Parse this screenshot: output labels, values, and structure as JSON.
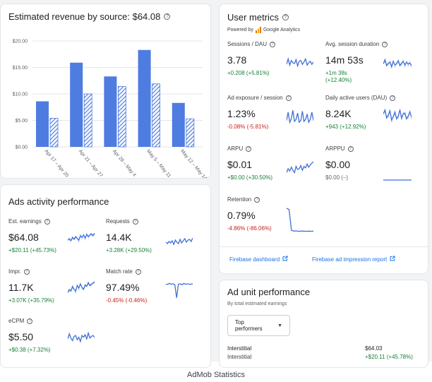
{
  "colors": {
    "bar_solid": "#4e7ce0",
    "bar_hatched": "#4e7ce0",
    "spark_primary": "#3f6fd6",
    "spark_secondary": "#b7c9f0",
    "positive": "#188038",
    "negative": "#c5221f",
    "link": "#1a73e8",
    "firebase_logo": "#f5a623"
  },
  "revenue_card": {
    "title": "Estimated revenue by source: $64.08",
    "help_icon": "help-circle-icon"
  },
  "chart_data": {
    "type": "bar",
    "categories": [
      "Apr 17 – Apr 20",
      "Apr 21 – Apr 27",
      "Apr 28 – May 4",
      "May 5 – May 11",
      "May 12 – May 14"
    ],
    "series": [
      {
        "values": [
          8.6,
          15.9,
          13.3,
          18.3,
          8.3
        ]
      },
      {
        "values": [
          5.4,
          10.0,
          11.4,
          11.9,
          5.3
        ]
      }
    ],
    "ylim": [
      0,
      20
    ],
    "yticks": [
      "$0.00",
      "$5.00",
      "$10.00",
      "$15.00",
      "$20.00"
    ],
    "ytick_values": [
      0,
      5,
      10,
      15,
      20
    ],
    "grid": true
  },
  "ads_card": {
    "title": "Ads activity performance",
    "metrics": [
      {
        "label": "Est. earnings",
        "value": "$64.08",
        "delta": "+$20.11 (+45.73%)",
        "trend": "positive"
      },
      {
        "label": "Requests",
        "value": "14.4K",
        "delta": "+3.28K (+29.50%)",
        "trend": "positive"
      },
      {
        "label": "Impr.",
        "value": "11.7K",
        "delta": "+3.07K (+35.79%)",
        "trend": "positive"
      },
      {
        "label": "Match rate",
        "value": "97.49%",
        "delta": "-0.45% (-0.46%)",
        "trend": "negative"
      },
      {
        "label": "eCPM",
        "value": "$5.50",
        "delta": "+$0.38 (+7.32%)",
        "trend": "positive"
      }
    ]
  },
  "user_card": {
    "title": "User metrics",
    "powered_by": "Powered by",
    "analytics": "Google Analytics",
    "metrics": [
      {
        "label": "Sessions / DAU",
        "value": "3.78",
        "delta": "+0.208 (+5.81%)",
        "trend": "positive"
      },
      {
        "label": "Avg. session duration",
        "value": "14m 53s",
        "delta": "+1m 38s\n(+12.40%)",
        "trend": "positive"
      },
      {
        "label": "Ad exposure / session",
        "value": "1.23%",
        "delta": "-0.08% (-5.81%)",
        "trend": "negative"
      },
      {
        "label": "Daily active users (DAU)",
        "value": "8.24K",
        "delta": "+943 (+12.92%)",
        "trend": "positive"
      },
      {
        "label": "ARPU",
        "value": "$0.01",
        "delta": "+$0.00 (+30.50%)",
        "trend": "positive"
      },
      {
        "label": "ARPPU",
        "value": "$0.00",
        "delta": "$0.00 (–)",
        "trend": "neutral"
      },
      {
        "label": "Retention",
        "value": "0.79%",
        "delta": "-4.86% (-86.06%)",
        "trend": "negative"
      }
    ],
    "links": {
      "firebase_dashboard": "Firebase dashboard",
      "firebase_impression": "Firebase ad impression report"
    }
  },
  "ad_unit_card": {
    "title": "Ad unit performance",
    "subtitle": "By total estimated earnings",
    "dropdown": "Top performers",
    "row_name": "Interstitial",
    "row_sub": "Interstitial",
    "row_value": "$64.03",
    "row_delta": "+$20.11 (+45.78%)"
  },
  "footer_caption": "AdMob Statistics"
}
